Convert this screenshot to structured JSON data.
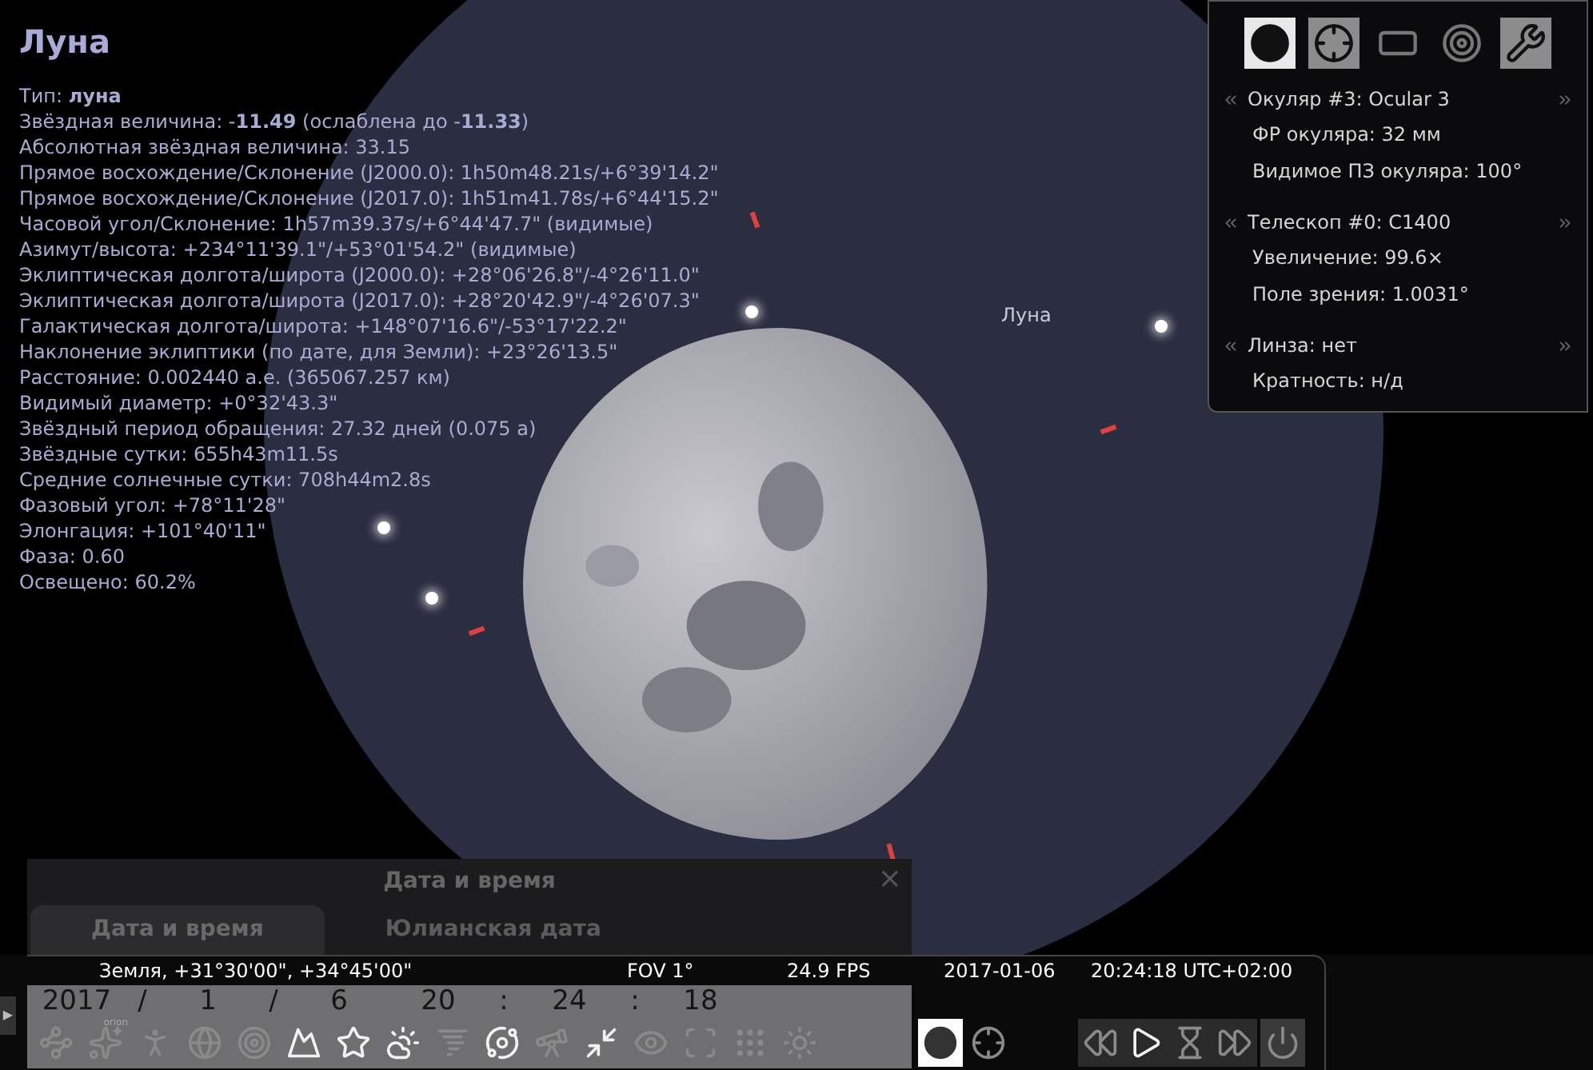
{
  "object": {
    "title": "Луна",
    "lines": [
      "Тип: **луна**",
      "Звёздная величина: -**11.49** (ослаблена до -**11.33**)",
      "Абсолютная звёздная величина: 33.15",
      "Прямое восхождение/Склонение (J2000.0): 1h50m48.21s/+6°39'14.2\"",
      "Прямое восхождение/Склонение (J2017.0): 1h51m41.78s/+6°44'15.2\"",
      "Часовой угол/Склонение: 1h57m39.37s/+6°44'47.7\" (видимые)",
      "Азимут/высота: +234°11'39.1\"/+53°01'54.2\" (видимые)",
      "Эклиптическая долгота/широта (J2000.0): +28°06'26.8\"/-4°26'11.0\"",
      "Эклиптическая долгота/широта (J2017.0): +28°20'42.9\"/-4°26'07.3\"",
      "Галактическая долгота/широта: +148°07'16.6\"/-53°17'22.2\"",
      "Наклонение эклиптики (по дате, для Земли): +23°26'13.5\"",
      "Расстояние: 0.002440 а.е. (365067.257 км)",
      "Видимый диаметр: +0°32'43.3\"",
      "Звёздный период обращения: 27.32 дней (0.075 а)",
      "Звёздные сутки: 655h43m11.5s",
      "Средние солнечные сутки: 708h44m2.8s",
      "Фазовый угол: +78°11'28\"",
      "Элонгация: +101°40'11\"",
      "Фаза: 0.60",
      "Освещено: 60.2%"
    ]
  },
  "sky_label": "Луна",
  "oculars": {
    "tools": [
      {
        "kind": "ocular",
        "selected": true,
        "on": true
      },
      {
        "kind": "crosshair",
        "selected": false,
        "on": true
      },
      {
        "kind": "sensor",
        "selected": false,
        "on": false
      },
      {
        "kind": "telrad",
        "selected": false,
        "on": false
      },
      {
        "kind": "settings",
        "selected": false,
        "on": true
      }
    ],
    "sections": [
      {
        "header": "Окуляр #3: Ocular 3",
        "lines": [
          "ФР окуляра: 32 мм",
          "Видимое ПЗ окуляра: 100°"
        ]
      },
      {
        "header": "Телескоп #0: C1400",
        "lines": [
          "Увеличение: 99.6×",
          "Поле зрения: 1.0031°"
        ]
      },
      {
        "header": "Линза: нет",
        "lines": [
          "Кратность: н/д"
        ]
      }
    ]
  },
  "date_dialog": {
    "title": "Дата и время",
    "close": "×",
    "tabs": [
      {
        "label": "Дата и время",
        "selected": true
      },
      {
        "label": "Юлианская дата",
        "selected": false
      }
    ],
    "fields": [
      {
        "kind": "value",
        "text": "2017"
      },
      {
        "kind": "separator",
        "text": "/"
      },
      {
        "kind": "value",
        "text": "1"
      },
      {
        "kind": "separator",
        "text": "/"
      },
      {
        "kind": "value",
        "text": "6"
      },
      {
        "kind": "value",
        "text": "20"
      },
      {
        "kind": "separator",
        "text": ":"
      },
      {
        "kind": "value",
        "text": "24"
      },
      {
        "kind": "separator",
        "text": ":"
      },
      {
        "kind": "value",
        "text": "18"
      }
    ]
  },
  "bottom_bar": {
    "toggle": "▶",
    "location": "Земля, +31°30'00\", +34°45'00\"",
    "fov": "FOV 1°",
    "fps": "24.9 FPS",
    "date": "2017-01-06",
    "time": "20:24:18 UTC+02:00",
    "buttons": [
      {
        "kind": "constellation-lines",
        "on": false
      },
      {
        "kind": "constellation-labels",
        "on": false,
        "label": "orion"
      },
      {
        "kind": "constellation-art",
        "on": false
      },
      {
        "kind": "equatorial-grid",
        "on": false
      },
      {
        "kind": "azimuthal-grid",
        "on": false
      },
      {
        "kind": "ground",
        "on": true
      },
      {
        "kind": "cardinal-points",
        "on": true
      },
      {
        "kind": "atmosphere",
        "on": true
      },
      {
        "kind": "nebulae",
        "on": false
      },
      {
        "kind": "planets",
        "on": true
      },
      {
        "kind": "telescope",
        "on": false
      },
      {
        "kind": "zoom",
        "on": true
      },
      {
        "kind": "eye",
        "on": false
      },
      {
        "kind": "frame",
        "on": false
      },
      {
        "kind": "dots",
        "on": false
      },
      {
        "kind": "rays",
        "on": false
      },
      {
        "kind": "ocular",
        "on": true
      },
      {
        "kind": "crosshair",
        "on": false
      }
    ],
    "time_buttons": [
      {
        "kind": "rewind",
        "on": false
      },
      {
        "kind": "play",
        "on": true
      },
      {
        "kind": "realtime",
        "on": false
      },
      {
        "kind": "forward",
        "on": false
      },
      {
        "kind": "quit",
        "on": false
      }
    ]
  }
}
